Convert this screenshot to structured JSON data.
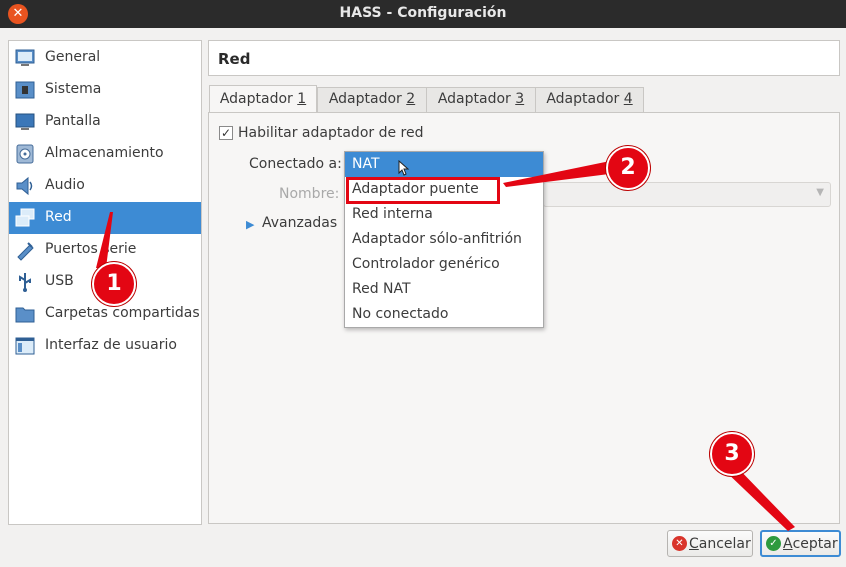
{
  "window": {
    "title": "HASS - Configuración",
    "close_glyph": "✕"
  },
  "sidebar": {
    "items": [
      {
        "label": "General",
        "icon": "general-icon"
      },
      {
        "label": "Sistema",
        "icon": "system-chip-icon"
      },
      {
        "label": "Pantalla",
        "icon": "display-icon"
      },
      {
        "label": "Almacenamiento",
        "icon": "storage-disk-icon"
      },
      {
        "label": "Audio",
        "icon": "speaker-icon"
      },
      {
        "label": "Red",
        "icon": "network-icon",
        "selected": true
      },
      {
        "label": "Puertos serie",
        "icon": "serial-port-icon"
      },
      {
        "label": "USB",
        "icon": "usb-icon"
      },
      {
        "label": "Carpetas compartidas",
        "icon": "folder-icon"
      },
      {
        "label": "Interfaz de usuario",
        "icon": "user-interface-icon"
      }
    ]
  },
  "section": {
    "title": "Red"
  },
  "tabs": [
    {
      "prefix": "Adaptador ",
      "key": "1",
      "active": true
    },
    {
      "prefix": "Adaptador ",
      "key": "2"
    },
    {
      "prefix": "Adaptador ",
      "key": "3"
    },
    {
      "prefix": "Adaptador ",
      "key": "4"
    }
  ],
  "adapter": {
    "enable_checked": true,
    "checkmark": "✓",
    "enable_label": "Habilitar adaptador de red",
    "connected_label": "Conectado a:",
    "name_label": "Nombre:",
    "advanced_label": "Avanzadas",
    "advanced_arrow": "▶",
    "name_arrow": "▼",
    "attachment_options": [
      "NAT",
      "Adaptador puente",
      "Red interna",
      "Adaptador sólo-anfitrión",
      "Controlador genérico",
      "Red NAT",
      "No conectado"
    ],
    "selected_option": "NAT",
    "highlighted_option": "Adaptador puente"
  },
  "buttons": {
    "cancel_key": "C",
    "cancel_rest": "ancelar",
    "cancel_glyph": "✕",
    "accept_key": "A",
    "accept_rest": "ceptar",
    "accept_glyph": "✓"
  },
  "annotations": {
    "badges": [
      "1",
      "2",
      "3"
    ],
    "color": "#e30613"
  },
  "colors": {
    "selection": "#3d8bd4",
    "titlebar": "#2b2b2b",
    "close": "#e95420"
  }
}
